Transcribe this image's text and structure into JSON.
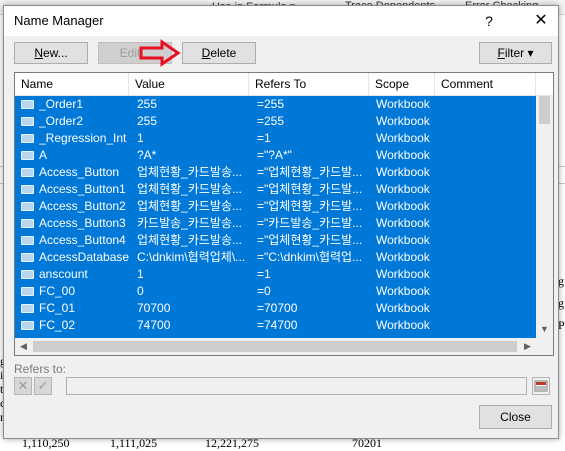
{
  "background": {
    "ribbon_items": [
      "Use in Formula ▾",
      "Trace Dependents",
      "Error Checking"
    ],
    "bottom_values": [
      "1,110,250",
      "1,111,025",
      "12,221,275",
      "70201"
    ],
    "left_glyphs": [
      "g",
      "i",
      "t",
      "ci",
      "n"
    ],
    "right_glyphs": [
      "g",
      "g",
      "P"
    ]
  },
  "dialog": {
    "title": "Name Manager",
    "help_icon": "?",
    "close_icon": "✕",
    "buttons": {
      "new_pre": "N",
      "new_post": "ew...",
      "edit": "Edit...",
      "delete_pre": "D",
      "delete_post": "elete",
      "filter_pre": "F",
      "filter_post": "ilter ▾",
      "close": "Close"
    },
    "arrow_color": "#e81123",
    "columns": [
      "Name",
      "Value",
      "Refers To",
      "Scope",
      "Comment"
    ],
    "rows": [
      {
        "name": "_Order1",
        "value": "255",
        "refers": "=255",
        "scope": "Workbook"
      },
      {
        "name": "_Order2",
        "value": "255",
        "refers": "=255",
        "scope": "Workbook"
      },
      {
        "name": "_Regression_Int",
        "value": "1",
        "refers": "=1",
        "scope": "Workbook"
      },
      {
        "name": "A",
        "value": "?A*",
        "refers": "=\"?A*\"",
        "scope": "Workbook"
      },
      {
        "name": "Access_Button",
        "value": "업체현황_카드발송...",
        "refers": "=\"업체현황_카드발...",
        "scope": "Workbook"
      },
      {
        "name": "Access_Button1",
        "value": "업체현황_카드발송...",
        "refers": "=\"업체현황_카드발...",
        "scope": "Workbook"
      },
      {
        "name": "Access_Button2",
        "value": "업체현황_카드발송...",
        "refers": "=\"업체현황_카드발...",
        "scope": "Workbook"
      },
      {
        "name": "Access_Button3",
        "value": "카드발송_카드발송...",
        "refers": "=\"카드발송_카드발...",
        "scope": "Workbook"
      },
      {
        "name": "Access_Button4",
        "value": "업체현황_카드발송...",
        "refers": "=\"업체현황_카드발...",
        "scope": "Workbook"
      },
      {
        "name": "AccessDatabase",
        "value": "C:\\dnkim\\협력업체\\...",
        "refers": "=\"C:\\dnkim\\협력업...",
        "scope": "Workbook"
      },
      {
        "name": "anscount",
        "value": "1",
        "refers": "=1",
        "scope": "Workbook"
      },
      {
        "name": "FC_00",
        "value": "0",
        "refers": "=0",
        "scope": "Workbook"
      },
      {
        "name": "FC_01",
        "value": "70700",
        "refers": "=70700",
        "scope": "Workbook"
      },
      {
        "name": "FC_02",
        "value": "74700",
        "refers": "=74700",
        "scope": "Workbook"
      },
      {
        "name": "",
        "value": "",
        "refers": "",
        "scope": ""
      }
    ],
    "refers_to_label": "Refers to:",
    "refers_to_value": "",
    "cancel_icon": "✕",
    "confirm_icon": "✓",
    "selection_color": "#0078d7"
  }
}
